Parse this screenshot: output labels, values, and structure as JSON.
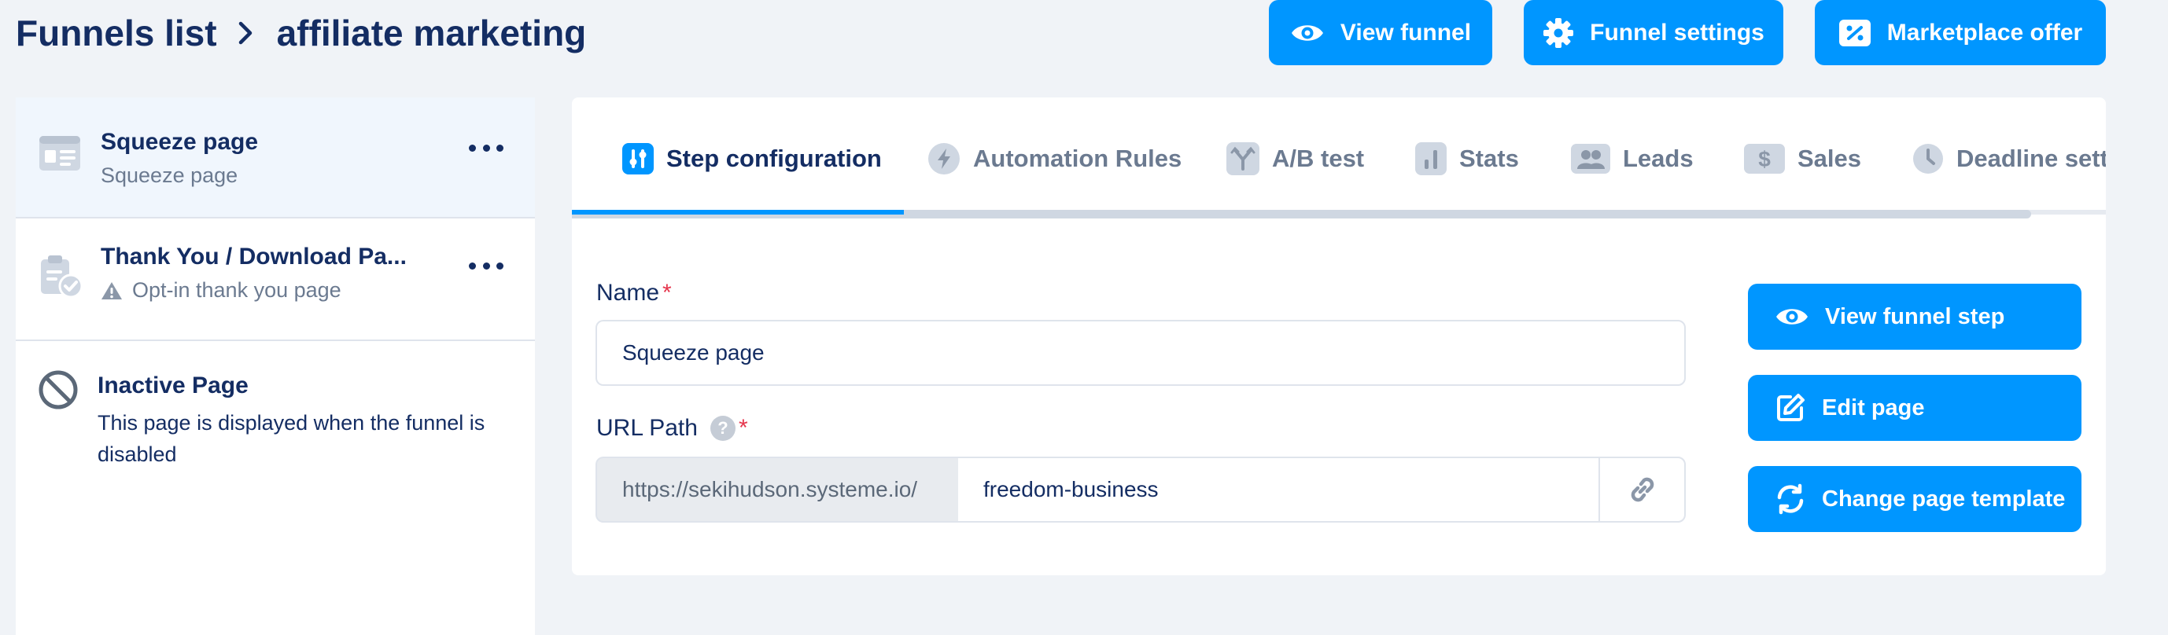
{
  "header": {
    "breadcrumb_root": "Funnels list",
    "breadcrumb_current": "affiliate marketing",
    "view_funnel_label": "View funnel",
    "funnel_settings_label": "Funnel settings",
    "marketplace_offer_label": "Marketplace offer"
  },
  "sidebar": {
    "steps": [
      {
        "title": "Squeeze page",
        "subtitle": "Squeeze page",
        "icon": "webpage-icon",
        "active": true
      },
      {
        "title": "Thank You / Download Pa...",
        "subtitle": "Opt-in thank you page",
        "icon": "clipboard-check-icon",
        "warning": true
      }
    ],
    "inactive": {
      "title": "Inactive Page",
      "description": "This page is displayed when the funnel is disabled",
      "icon": "ban-icon"
    }
  },
  "tabs": [
    {
      "label": "Step configuration",
      "icon": "sliders-icon",
      "active": true
    },
    {
      "label": "Automation Rules",
      "icon": "bolt-icon"
    },
    {
      "label": "A/B test",
      "icon": "split-icon"
    },
    {
      "label": "Stats",
      "icon": "bar-chart-icon"
    },
    {
      "label": "Leads",
      "icon": "users-icon"
    },
    {
      "label": "Sales",
      "icon": "dollar-icon"
    },
    {
      "label": "Deadline setti",
      "icon": "clock-icon"
    }
  ],
  "form": {
    "name_label": "Name",
    "name_value": "Squeeze page",
    "required_mark": "*",
    "url_label": "URL Path",
    "url_help": "?",
    "url_prefix": "https://sekihudson.systeme.io/",
    "url_path_value": "freedom-business"
  },
  "actions": {
    "view_step_label": "View funnel step",
    "edit_page_label": "Edit page",
    "change_template_label": "Change page template"
  },
  "colors": {
    "primary": "#0096ff",
    "text_dark": "#142d63",
    "text_muted": "#6b7a90",
    "background": "#f0f3f7",
    "required": "#e5364d"
  }
}
